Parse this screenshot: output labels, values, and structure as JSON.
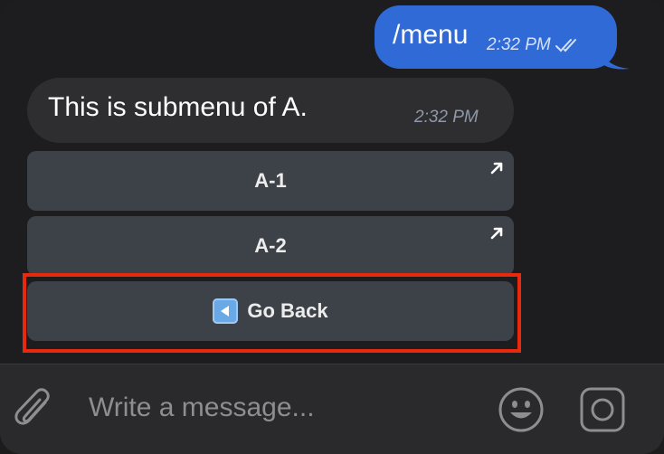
{
  "messages": {
    "outgoing": {
      "text": "/menu",
      "time": "2:32 PM"
    },
    "incoming": {
      "text": "This is submenu of A.",
      "time": "2:32 PM"
    }
  },
  "inline_keyboard": {
    "buttons": [
      {
        "label": "A-1",
        "icon": "arrow-up-right-icon"
      },
      {
        "label": "A-2",
        "icon": "arrow-up-right-icon"
      },
      {
        "label": "Go Back",
        "icon": "back-arrow-icon"
      }
    ],
    "highlighted": "Go Back"
  },
  "composer": {
    "placeholder": "Write a message..."
  },
  "colors": {
    "outgoing_bubble": "#2f6ad6",
    "incoming_bubble": "#2e2e31",
    "button_bg": "#3d4249",
    "highlight": "#e8290d",
    "background": "#1d1d1f"
  },
  "icons": [
    "paperclip-icon",
    "emoji-icon",
    "camera-icon",
    "double-check-icon"
  ]
}
